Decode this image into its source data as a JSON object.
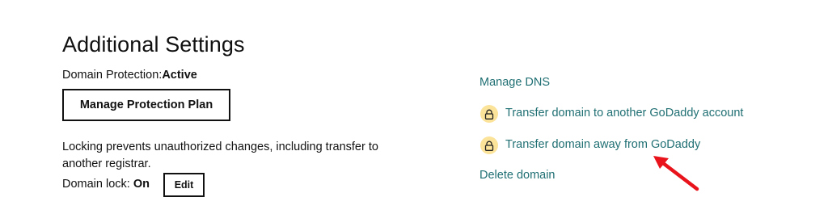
{
  "section": {
    "title": "Additional Settings"
  },
  "protection": {
    "label": "Domain Protection:",
    "status": "Active",
    "manage_button": "Manage Protection Plan"
  },
  "domain_lock": {
    "description": "Locking prevents unauthorized changes, including transfer to another registrar.",
    "label": "Domain lock:",
    "state": "On",
    "edit_button": "Edit"
  },
  "actions": {
    "manage_dns": "Manage DNS",
    "transfer_account": "Transfer domain to another GoDaddy account",
    "transfer_away": "Transfer domain away from GoDaddy",
    "delete_domain": "Delete domain"
  },
  "colors": {
    "link": "#1f6f73",
    "lock_badge": "#fbe39a",
    "annotation_arrow": "#e8131b"
  },
  "icons": {
    "lock": "lock-icon",
    "arrow": "annotation-arrow"
  }
}
